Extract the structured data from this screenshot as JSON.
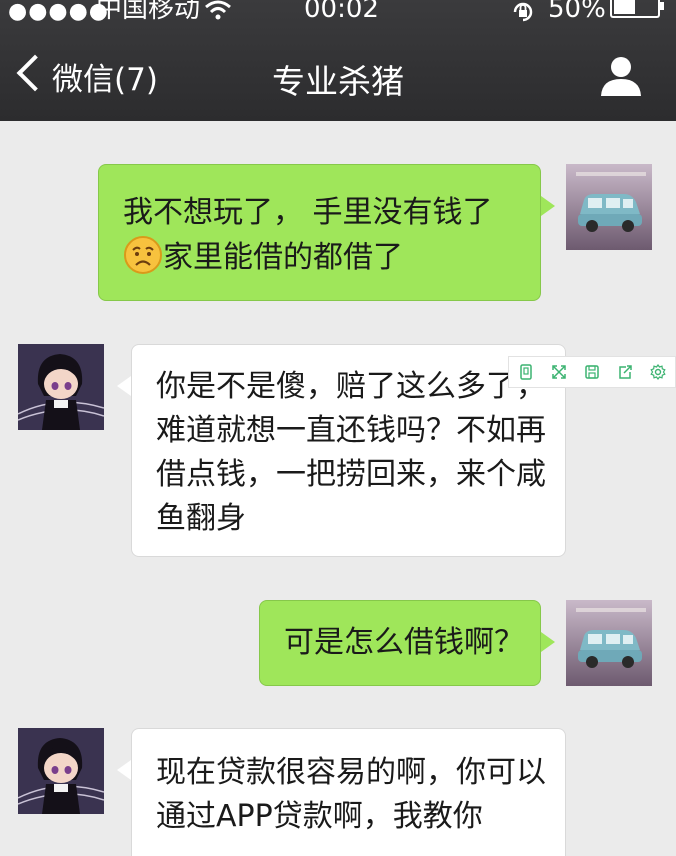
{
  "status_bar": {
    "signal": "●●●●●",
    "carrier": "中国移动",
    "time": "00:02",
    "battery": "50%"
  },
  "nav": {
    "back_label": "微信(7)",
    "title": "专业杀猪"
  },
  "messages": [
    {
      "side": "right",
      "lines": [
        "我不想玩了， 手里没有钱了",
        "家里能借的都借了"
      ],
      "emoji": "worried-face-icon"
    },
    {
      "side": "left",
      "lines": [
        "你是不是傻，赔了这么多了，",
        "难道就想一直还钱吗？不如再",
        "借点钱，一把捞回来，来个咸",
        "鱼翻身"
      ]
    },
    {
      "side": "right",
      "lines": [
        "可是怎么借钱啊？"
      ]
    },
    {
      "side": "left",
      "lines": [
        "现在贷款很容易的啊，你可以",
        "通过APP贷款啊，我教你"
      ]
    }
  ],
  "toolbar_icons": [
    "copy-icon",
    "expand-icon",
    "save-icon",
    "share-icon",
    "settings-icon"
  ],
  "colors": {
    "header": "#2e2e30",
    "background": "#ebebeb",
    "outgoing_bubble": "#9fe65a",
    "incoming_bubble": "#ffffff",
    "toolbar_icon": "#3cb371"
  }
}
